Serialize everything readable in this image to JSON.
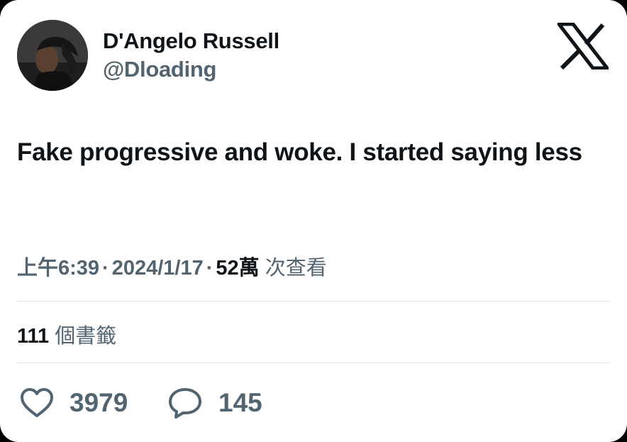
{
  "author": {
    "display_name": "D'Angelo Russell",
    "handle": "@Dloading",
    "avatar_icon": "profile-photo"
  },
  "platform": {
    "logo_icon": "x-logo"
  },
  "tweet": {
    "text": "Fake progressive and woke. I started saying less"
  },
  "meta": {
    "time": "上午6:39",
    "separator": "·",
    "date": "2024/1/17",
    "views_count": "52萬",
    "views_label": "次查看"
  },
  "bookmarks": {
    "count": "111",
    "label": "個書籤"
  },
  "actions": {
    "likes": {
      "icon": "heart-icon",
      "count": "3979"
    },
    "replies": {
      "icon": "reply-bubble-icon",
      "count": "145"
    }
  },
  "colors": {
    "primary_text": "#0f1419",
    "secondary_text": "#536471",
    "divider": "#dfe3e6",
    "background": "#ffffff"
  }
}
